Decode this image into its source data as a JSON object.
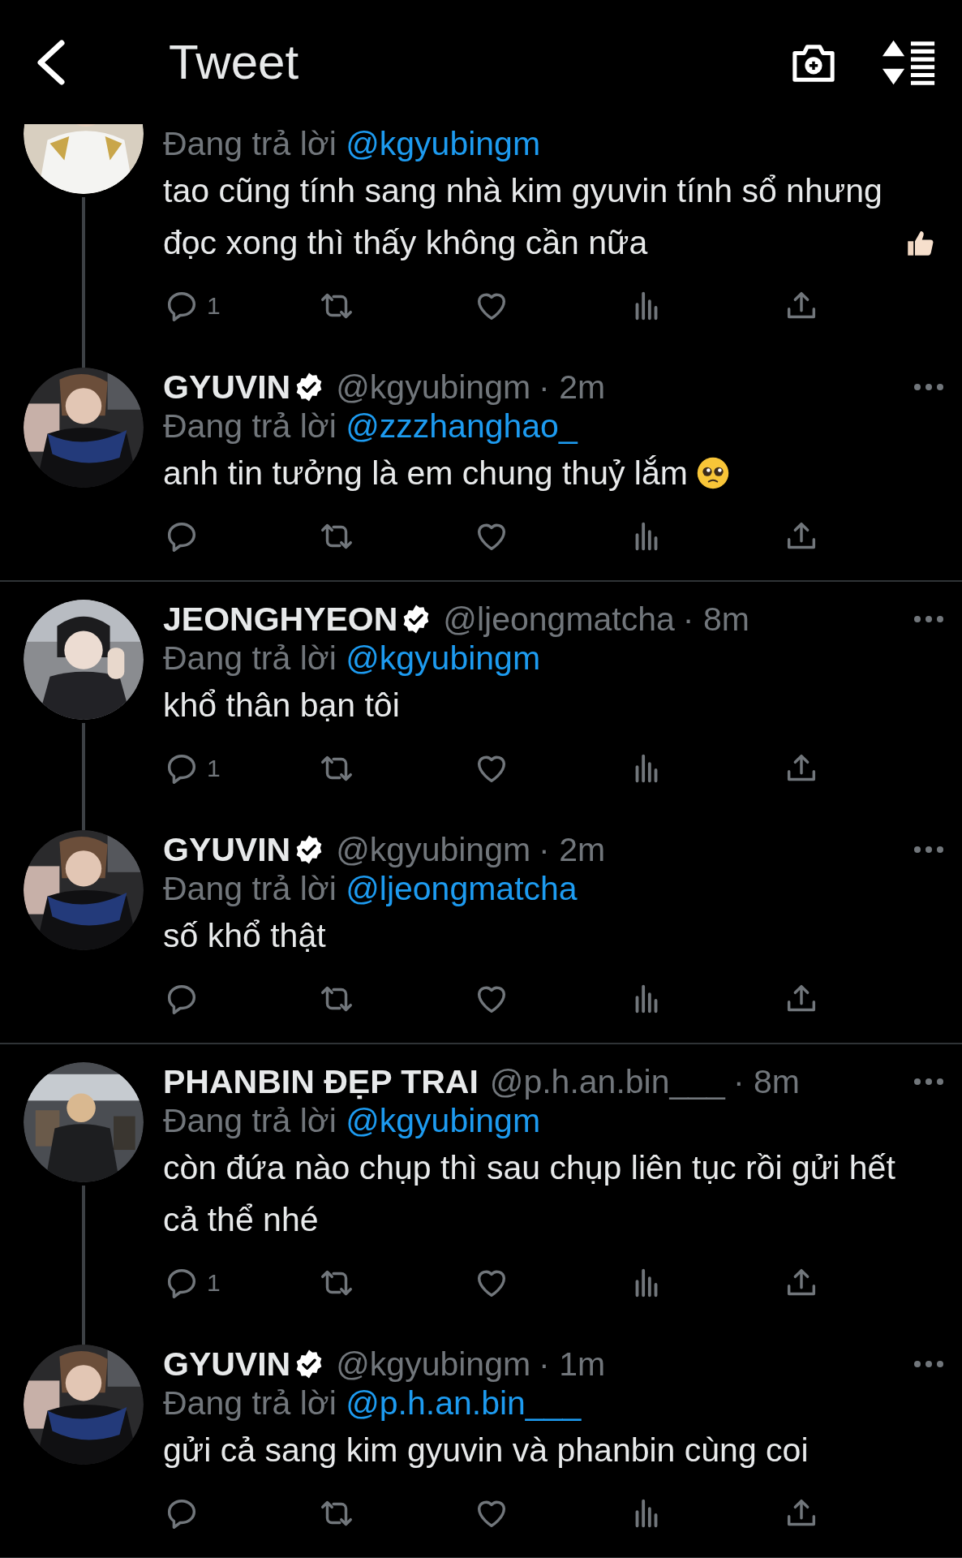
{
  "header": {
    "title": "Tweet"
  },
  "threads": [
    {
      "tweets": [
        {
          "reply_label": "Đang trả lời",
          "reply_to": "@kgyubingm",
          "text": "tao cũng tính sang nhà kim gyuvin tính sổ nhưng đọc xong thì thấy không cần nữa",
          "kind": "thumbsup",
          "reply_count": "1"
        },
        {
          "author": {
            "name": "GYUVIN",
            "verified": true,
            "handle": "@kgyubingm",
            "time": "· 2m"
          },
          "reply_label": "Đang trả lời",
          "reply_to": "@zzzhanghao_",
          "text": "anh tin tưởng là em chung thuỷ lắm",
          "kind": "pleading"
        }
      ]
    },
    {
      "tweets": [
        {
          "author": {
            "name": "JEONGHYEON",
            "verified": true,
            "handle": "@ljeongmatcha",
            "time": "· 8m"
          },
          "reply_label": "Đang trả lời",
          "reply_to": "@kgyubingm",
          "text": "khổ thân bạn tôi",
          "kind": "plain",
          "reply_count": "1"
        },
        {
          "author": {
            "name": "GYUVIN",
            "verified": true,
            "handle": "@kgyubingm",
            "time": "· 2m"
          },
          "reply_label": "Đang trả lời",
          "reply_to": "@ljeongmatcha",
          "text": "số khổ thật",
          "kind": "plain"
        }
      ]
    },
    {
      "tweets": [
        {
          "author": {
            "name": "PHANBIN ĐẸP TRAI",
            "verified": false,
            "handle": "@p.h.an.bin___",
            "time": "· 8m"
          },
          "reply_label": "Đang trả lời",
          "reply_to": "@kgyubingm",
          "text": "còn đứa nào chụp thì sau chụp liên tục rồi gửi hết cả thể nhé",
          "kind": "plain",
          "reply_count": "1"
        },
        {
          "author": {
            "name": "GYUVIN",
            "verified": true,
            "handle": "@kgyubingm",
            "time": "· 1m"
          },
          "reply_label": "Đang trả lời",
          "reply_to": "@p.h.an.bin___",
          "text": "gửi cả sang kim gyuvin và phanbin cùng coi",
          "kind": "plain"
        }
      ]
    }
  ]
}
